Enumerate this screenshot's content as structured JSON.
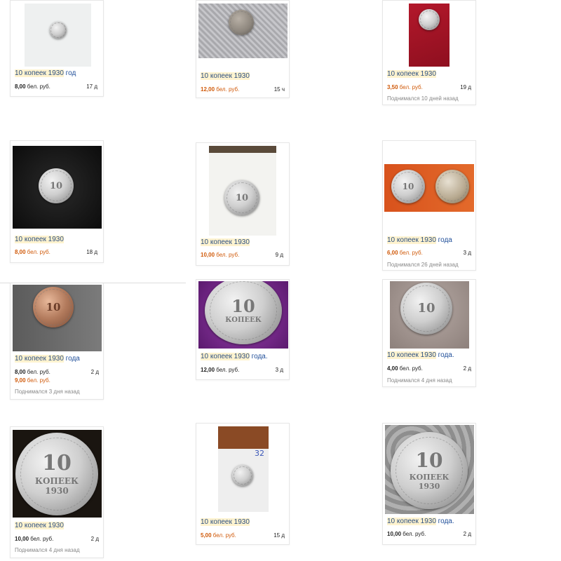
{
  "listings": [
    {
      "title_hl": "10 копеек 1930",
      "title_rest": " год",
      "price_val": "8,00",
      "price_cur": " бел. руб.",
      "price_color": "#222222",
      "age": "17 д"
    },
    {
      "title_hl": "10 копеек 1930",
      "title_rest": "",
      "price_val": "12,00",
      "price_cur": " бел. руб.",
      "price_color": "#d05a0a",
      "age": "15 ч"
    },
    {
      "title_hl": "10 копеек 1930",
      "title_rest": "",
      "price_val": "3,50",
      "price_cur": " бел. руб.",
      "price_color": "#d05a0a",
      "age": "19 д",
      "raised": "Поднимался 10 дней назад"
    },
    {
      "title_hl": "10 копеек 1930",
      "title_rest": "",
      "price_val": "8,00",
      "price_cur": " бел. руб.",
      "price_color": "#d05a0a",
      "age": "18 д"
    },
    {
      "title_hl": "10 копеек 1930",
      "title_rest": "",
      "price_val": "10,00",
      "price_cur": " бел. руб.",
      "price_color": "#d05a0a",
      "age": "9 д"
    },
    {
      "title_hl": "10 копеек 1930",
      "title_rest": " года",
      "price_val": "6,00",
      "price_cur": " бел. руб.",
      "price_color": "#d05a0a",
      "age": "3 д",
      "raised": "Поднимался 26 дней назад"
    },
    {
      "title_hl": "10 копеек 1930",
      "title_rest": " года",
      "price_val": "8,00",
      "price_cur": " бел. руб.",
      "price_color": "#222222",
      "price2_val": "9,00",
      "price2_cur": " бел. руб.",
      "price2_color": "#d05a0a",
      "age": "2 д",
      "raised": "Поднимался 3 дня назад"
    },
    {
      "title_hl": "10 копеек 1930",
      "title_rest": " года.",
      "price_val": "12,00",
      "price_cur": " бел. руб.",
      "price_color": "#222222",
      "age": "3 д"
    },
    {
      "title_hl": "10 копеек 1930",
      "title_rest": " года.",
      "price_val": "4,00",
      "price_cur": " бел. руб.",
      "price_color": "#222222",
      "age": "2 д",
      "raised": "Поднимался 4 дня назад"
    },
    {
      "title_hl": "10 копеек 1930",
      "title_rest": "",
      "price_val": "10,00",
      "price_cur": " бел. руб.",
      "price_color": "#222222",
      "age": "2 д",
      "raised": "Поднимался 4 дня назад"
    },
    {
      "title_hl": "10 копеек 1930",
      "title_rest": "",
      "price_val": "5,00",
      "price_cur": " бел. руб.",
      "price_color": "#d05a0a",
      "age": "15 д"
    },
    {
      "title_hl": "10 копеек 1930",
      "title_rest": " года.",
      "price_val": "10,00",
      "price_cur": " бел. руб.",
      "price_color": "#222222",
      "age": "2 д"
    }
  ],
  "coin": {
    "denomination": "10",
    "word": "КОПЕЕК",
    "year": "1930"
  },
  "photo_note": "32",
  "colors": {
    "title_highlight": "#fff3cf",
    "link": "#1f4e99",
    "price_orange": "#d05a0a",
    "muted": "#888888"
  }
}
